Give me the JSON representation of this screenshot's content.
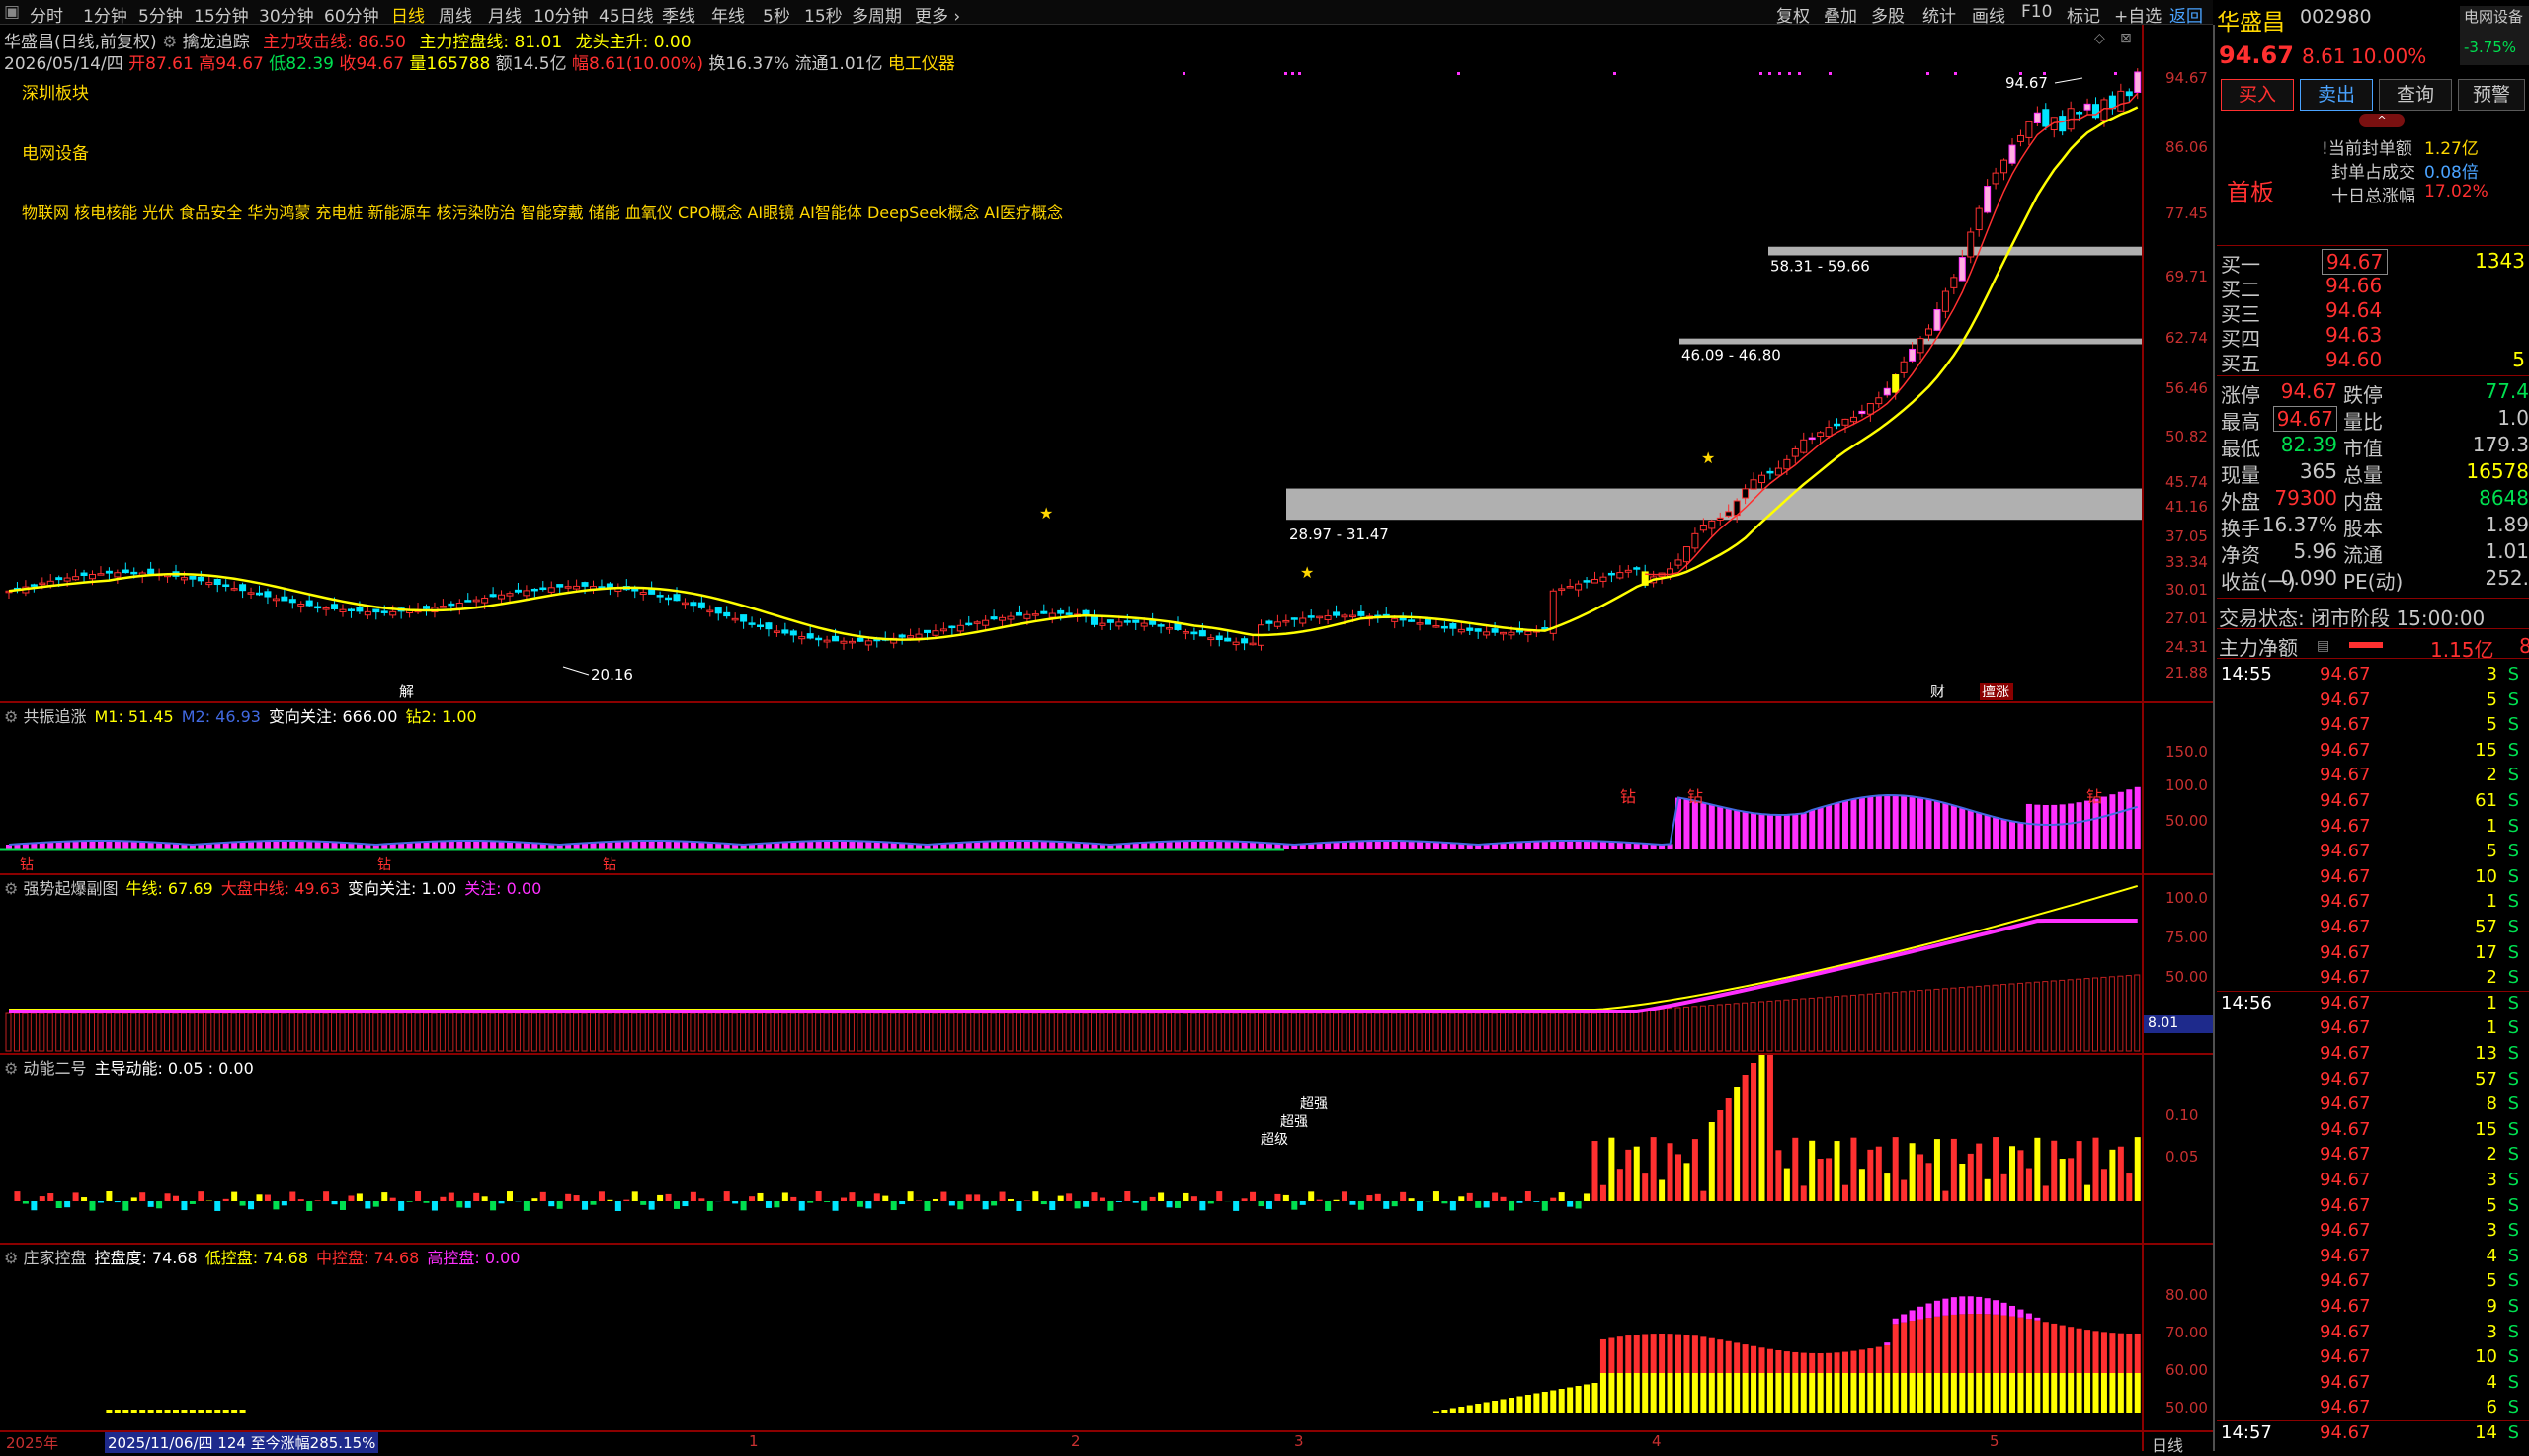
{
  "toolbar": {
    "periods": [
      "分时",
      "1分钟",
      "5分钟",
      "15分钟",
      "30分钟",
      "60分钟",
      "日线",
      "周线",
      "月线",
      "10分钟",
      "45日线",
      "季线",
      "年线",
      "5秒",
      "15秒",
      "多周期",
      "更多 ›"
    ],
    "active_period": "日线",
    "tools": [
      "复权",
      "叠加",
      "多股",
      "统计",
      "画线",
      "F10",
      "标记",
      "+自选",
      "返回"
    ]
  },
  "header": {
    "stock_line": "华盛昌(日线,前复权)",
    "formula": "擒龙追踪",
    "attack": "主力攻击线: 86.50",
    "control": "主力控盘线: 81.01",
    "dragon": "龙头主升: 0.00",
    "date": "2026/05/14/四",
    "open": "开87.61",
    "high": "高94.67",
    "low": "低82.39",
    "close": "收94.67",
    "volume": "量165788",
    "amount": "额14.5亿",
    "change": "幅8.61(10.00%)",
    "turnover": "换16.37%",
    "float": "流通1.01亿",
    "industry": "电工仪器",
    "board": "深圳板块",
    "sector": "电网设备",
    "concepts": "物联网 核电核能 光伏 食品安全 华为鸿蒙 充电桩 新能源车 核污染防治 智能穿戴 储能 血氧仪 CPO概念 AI眼镜 AI智能体 DeepSeek概念 AI医疗概念"
  },
  "main_chart": {
    "y_labels": [
      "94.67",
      "86.06",
      "77.45",
      "69.71",
      "62.74",
      "56.46",
      "50.82",
      "45.74",
      "41.16",
      "37.05",
      "33.34",
      "30.01",
      "27.01",
      "24.31",
      "21.88"
    ],
    "peak_label": "94.67",
    "low_label": "20.16",
    "zones": [
      {
        "label": "58.31 - 59.66"
      },
      {
        "label": "46.09 - 46.80"
      },
      {
        "label": "28.97 - 31.47"
      }
    ],
    "markers": {
      "jie": "解",
      "cai": "财",
      "shan": "擅涨"
    }
  },
  "panels": [
    {
      "title": "共振追涨",
      "items": [
        {
          "t": "M1: 51.45",
          "c": "#ffff00"
        },
        {
          "t": "M2: 46.93",
          "c": "#4169e1"
        },
        {
          "t": "变向关注: 666.00",
          "c": "#ffffff"
        },
        {
          "t": "钻2: 1.00",
          "c": "#ffff00"
        }
      ],
      "y_labels": [
        "150.0",
        "100.0",
        "50.00"
      ],
      "mark": "钻"
    },
    {
      "title": "强势起爆副图",
      "items": [
        {
          "t": "牛线: 67.69",
          "c": "#ffff00"
        },
        {
          "t": "大盘中线: 49.63",
          "c": "#ff3030"
        },
        {
          "t": "变向关注: 1.00",
          "c": "#ffffff"
        },
        {
          "t": "关注: 0.00",
          "c": "#ff30ff"
        }
      ],
      "y_labels": [
        "100.0",
        "75.00",
        "50.00"
      ],
      "tag": "8.01"
    },
    {
      "title": "动能二号",
      "items": [
        {
          "t": "主导动能: 0.05 : 0.00",
          "c": "#ffffff"
        }
      ],
      "y_labels": [
        "0.10",
        "0.05"
      ],
      "marks": [
        "超级",
        "超强",
        "超强"
      ]
    },
    {
      "title": "庄家控盘",
      "items": [
        {
          "t": "控盘度: 74.68",
          "c": "#ffffff"
        },
        {
          "t": "低控盘: 74.68",
          "c": "#ffff00"
        },
        {
          "t": "中控盘: 74.68",
          "c": "#ff3030"
        },
        {
          "t": "高控盘: 0.00",
          "c": "#ff30ff"
        }
      ],
      "y_labels": [
        "80.00",
        "70.00",
        "60.00",
        "50.00"
      ]
    }
  ],
  "xaxis": {
    "year": "2025年",
    "range": "2025/11/06/四 124 至今涨幅285.15%",
    "months": [
      "1",
      "2",
      "3",
      "4",
      "5"
    ],
    "period": "日线"
  },
  "right": {
    "name": "华盛昌",
    "code": "002980",
    "corner": "电网设备",
    "corner_pct": "-3.75%",
    "price": "94.67",
    "chg": "8.61",
    "pct": "10.00%",
    "buttons": [
      "买入",
      "卖出",
      "查询",
      "预警"
    ],
    "first_board": "首板",
    "sealed_label": "!当前封单额",
    "sealed_val": "1.27亿",
    "ratio_label": "封单占成交",
    "ratio_val": "0.08倍",
    "ten_label": "十日总涨幅",
    "ten_val": "17.02%",
    "bids": [
      {
        "label": "买一",
        "price": "94.67",
        "vol": "1343"
      },
      {
        "label": "买二",
        "price": "94.66",
        "vol": ""
      },
      {
        "label": "买三",
        "price": "94.64",
        "vol": ""
      },
      {
        "label": "买四",
        "price": "94.63",
        "vol": ""
      },
      {
        "label": "买五",
        "price": "94.60",
        "vol": "5"
      }
    ],
    "stats": [
      {
        "l1": "涨停",
        "v1": "94.67",
        "l2": "跌停",
        "v2": "77.4"
      },
      {
        "l1": "最高",
        "v1": "94.67",
        "l2": "量比",
        "v2": "1.0"
      },
      {
        "l1": "最低",
        "v1": "82.39",
        "l2": "市值",
        "v2": "179.3"
      },
      {
        "l1": "现量",
        "v1": "365",
        "l2": "总量",
        "v2": "16578"
      },
      {
        "l1": "外盘",
        "v1": "79300",
        "l2": "内盘",
        "v2": "8648"
      },
      {
        "l1": "换手",
        "v1": "16.37%",
        "l2": "股本",
        "v2": "1.89"
      },
      {
        "l1": "净资",
        "v1": "5.96",
        "l2": "流通",
        "v2": "1.01"
      },
      {
        "l1": "收益(一)",
        "v1": "0.090",
        "l2": "PE(动)",
        "v2": "252."
      }
    ],
    "trade_state": "交易状态: 闭市阶段 15:00:00",
    "net_label": "主力净额",
    "net_val": "1.15亿",
    "net_extra": "8",
    "ticks": [
      {
        "time": "14:55",
        "price": "94.67",
        "vol": "3",
        "side": "S"
      },
      {
        "time": "",
        "price": "94.67",
        "vol": "5",
        "side": "S"
      },
      {
        "time": "",
        "price": "94.67",
        "vol": "5",
        "side": "S"
      },
      {
        "time": "",
        "price": "94.67",
        "vol": "15",
        "side": "S"
      },
      {
        "time": "",
        "price": "94.67",
        "vol": "2",
        "side": "S"
      },
      {
        "time": "",
        "price": "94.67",
        "vol": "61",
        "side": "S"
      },
      {
        "time": "",
        "price": "94.67",
        "vol": "1",
        "side": "S"
      },
      {
        "time": "",
        "price": "94.67",
        "vol": "5",
        "side": "S"
      },
      {
        "time": "",
        "price": "94.67",
        "vol": "10",
        "side": "S"
      },
      {
        "time": "",
        "price": "94.67",
        "vol": "1",
        "side": "S"
      },
      {
        "time": "",
        "price": "94.67",
        "vol": "57",
        "side": "S"
      },
      {
        "time": "",
        "price": "94.67",
        "vol": "17",
        "side": "S"
      },
      {
        "time": "",
        "price": "94.67",
        "vol": "2",
        "side": "S"
      },
      {
        "time": "14:56",
        "price": "94.67",
        "vol": "1",
        "side": "S"
      },
      {
        "time": "",
        "price": "94.67",
        "vol": "1",
        "side": "S"
      },
      {
        "time": "",
        "price": "94.67",
        "vol": "13",
        "side": "S"
      },
      {
        "time": "",
        "price": "94.67",
        "vol": "57",
        "side": "S"
      },
      {
        "time": "",
        "price": "94.67",
        "vol": "8",
        "side": "S"
      },
      {
        "time": "",
        "price": "94.67",
        "vol": "15",
        "side": "S"
      },
      {
        "time": "",
        "price": "94.67",
        "vol": "2",
        "side": "S"
      },
      {
        "time": "",
        "price": "94.67",
        "vol": "3",
        "side": "S"
      },
      {
        "time": "",
        "price": "94.67",
        "vol": "5",
        "side": "S"
      },
      {
        "time": "",
        "price": "94.67",
        "vol": "3",
        "side": "S"
      },
      {
        "time": "",
        "price": "94.67",
        "vol": "4",
        "side": "S"
      },
      {
        "time": "",
        "price": "94.67",
        "vol": "5",
        "side": "S"
      },
      {
        "time": "",
        "price": "94.67",
        "vol": "9",
        "side": "S"
      },
      {
        "time": "",
        "price": "94.67",
        "vol": "3",
        "side": "S"
      },
      {
        "time": "",
        "price": "94.67",
        "vol": "10",
        "side": "S"
      },
      {
        "time": "",
        "price": "94.67",
        "vol": "4",
        "side": "S"
      },
      {
        "time": "",
        "price": "94.67",
        "vol": "6",
        "side": "S"
      },
      {
        "time": "14:57",
        "price": "94.67",
        "vol": "14",
        "side": "S"
      }
    ]
  },
  "colors": {
    "up": "#ff3030",
    "down": "#00e5ff",
    "ma": "#ffff00",
    "magenta": "#ff30ff",
    "grid": "#8b0000",
    "gold": "#ffd700"
  }
}
